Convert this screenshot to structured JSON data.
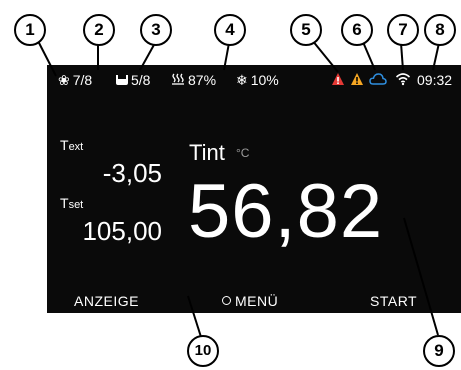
{
  "status_bar": {
    "fan": {
      "icon": "fan-icon",
      "text": "7/8"
    },
    "bath": {
      "icon": "bath-icon",
      "text": "5/8"
    },
    "heating": {
      "icon": "heating-icon",
      "text": "87%"
    },
    "cooling": {
      "icon": "snowflake-icon",
      "text": "10%"
    },
    "alarm_icon": "alarm-warning-icon",
    "warning_icon": "warning-icon",
    "cloud_icon": "cloud-icon",
    "wifi_icon": "wifi-icon",
    "time": "09:32"
  },
  "readings": {
    "text_label": "T",
    "text_sub": "ext",
    "text_value": "-3,05",
    "tset_label": "T",
    "tset_sub": "set",
    "tset_value": "105,00",
    "tint_label": "Tint",
    "tint_unit": "°C",
    "tint_value": "56,82"
  },
  "softkeys": {
    "left": "ANZEIGE",
    "middle": "MENÜ",
    "right": "START"
  },
  "callouts": [
    "1",
    "2",
    "3",
    "4",
    "5",
    "6",
    "7",
    "8",
    "9",
    "10"
  ],
  "colors": {
    "screen_bg": "#0a0a0a",
    "alarm_red": "#e53935",
    "warning_orange": "#f5a623",
    "cloud_blue": "#2f8fe0",
    "text": "#ffffff"
  }
}
